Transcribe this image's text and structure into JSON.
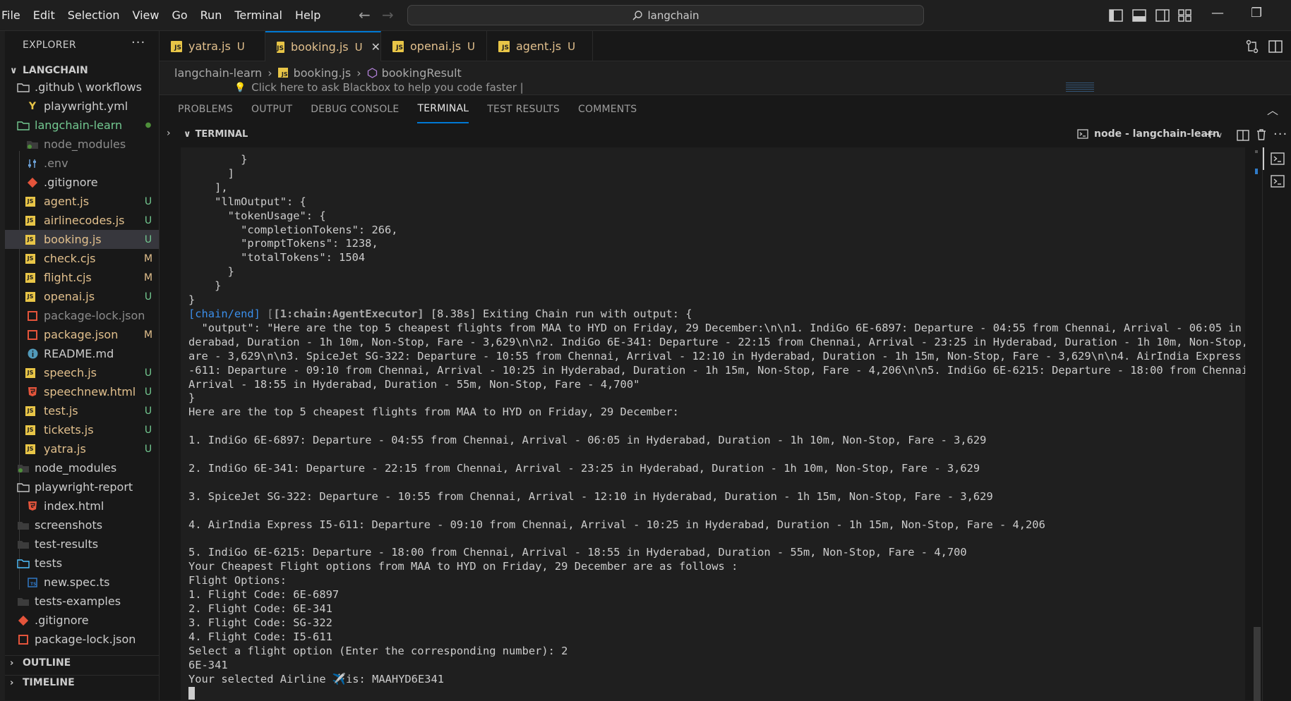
{
  "menu": [
    "File",
    "Edit",
    "Selection",
    "View",
    "Go",
    "Run",
    "Terminal",
    "Help"
  ],
  "command_center": {
    "text": "langchain"
  },
  "sidebar": {
    "title": "EXPLORER",
    "more": "···",
    "root": "LANGCHAIN",
    "items": [
      {
        "label": ".github \\ workflows",
        "badge": ""
      },
      {
        "label": "playwright.yml",
        "badge": ""
      },
      {
        "label": "langchain-learn",
        "badge": "●"
      },
      {
        "label": "node_modules",
        "badge": ""
      },
      {
        "label": ".env",
        "badge": ""
      },
      {
        "label": ".gitignore",
        "badge": ""
      },
      {
        "label": "agent.js",
        "badge": "U"
      },
      {
        "label": "airlinecodes.js",
        "badge": "U"
      },
      {
        "label": "booking.js",
        "badge": "U"
      },
      {
        "label": "check.cjs",
        "badge": "M"
      },
      {
        "label": "flight.cjs",
        "badge": "M"
      },
      {
        "label": "openai.js",
        "badge": "U"
      },
      {
        "label": "package-lock.json",
        "badge": ""
      },
      {
        "label": "package.json",
        "badge": "M"
      },
      {
        "label": "README.md",
        "badge": ""
      },
      {
        "label": "speech.js",
        "badge": "U"
      },
      {
        "label": "speechnew.html",
        "badge": "U"
      },
      {
        "label": "test.js",
        "badge": "U"
      },
      {
        "label": "tickets.js",
        "badge": "U"
      },
      {
        "label": "yatra.js",
        "badge": "U"
      },
      {
        "label": "node_modules",
        "badge": ""
      },
      {
        "label": "playwright-report",
        "badge": ""
      },
      {
        "label": "index.html",
        "badge": ""
      },
      {
        "label": "screenshots",
        "badge": ""
      },
      {
        "label": "test-results",
        "badge": ""
      },
      {
        "label": "tests",
        "badge": ""
      },
      {
        "label": "new.spec.ts",
        "badge": ""
      },
      {
        "label": "tests-examples",
        "badge": ""
      },
      {
        "label": ".gitignore",
        "badge": ""
      },
      {
        "label": "package-lock.json",
        "badge": ""
      }
    ],
    "outline": "OUTLINE",
    "timeline": "TIMELINE"
  },
  "tabs": [
    {
      "label": "yatra.js",
      "badge": "U"
    },
    {
      "label": "booking.js",
      "badge": "U"
    },
    {
      "label": "openai.js",
      "badge": "U"
    },
    {
      "label": "agent.js",
      "badge": "U"
    }
  ],
  "breadcrumb": {
    "folder": "langchain-learn",
    "file": "booking.js",
    "symbol": "bookingResult"
  },
  "blackbox_hint": "Click here to ask Blackbox to help you code faster |",
  "panel": {
    "tabs": [
      "PROBLEMS",
      "OUTPUT",
      "DEBUG CONSOLE",
      "TERMINAL",
      "TEST RESULTS",
      "COMMENTS"
    ],
    "terminal_title": "TERMINAL",
    "terminal_name": "node - langchain-learn"
  },
  "terminal": {
    "lines_a": "        }\n      ]\n    ],\n    \"llmOutput\": {\n      \"tokenUsage\": {\n        \"completionTokens\": 266,\n        \"promptTokens\": 1238,\n        \"totalTokens\": 1504\n      }\n    }\n}",
    "chain_tag": "[chain/end]",
    "agent_tag": "[1:chain:AgentExecutor]",
    "chain_rest": " [8.38s] Exiting Chain run with output: {",
    "lines_b": "  \"output\": \"Here are the top 5 cheapest flights from MAA to HYD on Friday, 29 December:\\n\\n1. IndiGo 6E-6897: Departure - 04:55 from Chennai, Arrival - 06:05 in Hy\nderabad, Duration - 1h 10m, Non-Stop, Fare - 3,629\\n\\n2. IndiGo 6E-341: Departure - 22:15 from Chennai, Arrival - 23:25 in Hyderabad, Duration - 1h 10m, Non-Stop, F\nare - 3,629\\n\\n3. SpiceJet SG-322: Departure - 10:55 from Chennai, Arrival - 12:10 in Hyderabad, Duration - 1h 15m, Non-Stop, Fare - 3,629\\n\\n4. AirIndia Express I5\n-611: Departure - 09:10 from Chennai, Arrival - 10:25 in Hyderabad, Duration - 1h 15m, Non-Stop, Fare - 4,206\\n\\n5. IndiGo 6E-6215: Departure - 18:00 from Chennai,\nArrival - 18:55 in Hyderabad, Duration - 55m, Non-Stop, Fare - 4,700\"\n}\nHere are the top 5 cheapest flights from MAA to HYD on Friday, 29 December:\n\n1. IndiGo 6E-6897: Departure - 04:55 from Chennai, Arrival - 06:05 in Hyderabad, Duration - 1h 10m, Non-Stop, Fare - 3,629\n\n2. IndiGo 6E-341: Departure - 22:15 from Chennai, Arrival - 23:25 in Hyderabad, Duration - 1h 10m, Non-Stop, Fare - 3,629\n\n3. SpiceJet SG-322: Departure - 10:55 from Chennai, Arrival - 12:10 in Hyderabad, Duration - 1h 15m, Non-Stop, Fare - 3,629\n\n4. AirIndia Express I5-611: Departure - 09:10 from Chennai, Arrival - 10:25 in Hyderabad, Duration - 1h 15m, Non-Stop, Fare - 4,206\n\n5. IndiGo 6E-6215: Departure - 18:00 from Chennai, Arrival - 18:55 in Hyderabad, Duration - 55m, Non-Stop, Fare - 4,700\nYour Cheapest Flight options from MAA to HYD on Friday, 29 December are as follows :\nFlight Options:\n1. Flight Code: 6E-6897\n2. Flight Code: 6E-341\n3. Flight Code: SG-322\n4. Flight Code: I5-611\nSelect a flight option (Enter the corresponding number): 2\n6E-341\nYour selected Airline ✈️is: MAAHYD6E341\n"
  },
  "colors": {
    "accent": "#0078d4",
    "untracked": "#73c991",
    "modified": "#e2c08d",
    "js_icon": "#e8c547",
    "terminal_blue": "#3b8eea"
  },
  "icons": {
    "nav_back": "arrow-left-icon",
    "nav_forward": "arrow-right-icon",
    "search": "search-icon",
    "layout": [
      "layout-sidebar-left-icon",
      "layout-panel-icon",
      "layout-sidebar-right-icon",
      "customize-layout-icon"
    ],
    "window": [
      "minimize-icon",
      "restore-icon"
    ],
    "editor_actions": [
      "compare-changes-icon",
      "split-editor-icon"
    ],
    "panel": [
      "chevron-up-icon",
      "add-terminal-icon",
      "split-terminal-icon",
      "trash-icon",
      "more-icon"
    ]
  }
}
